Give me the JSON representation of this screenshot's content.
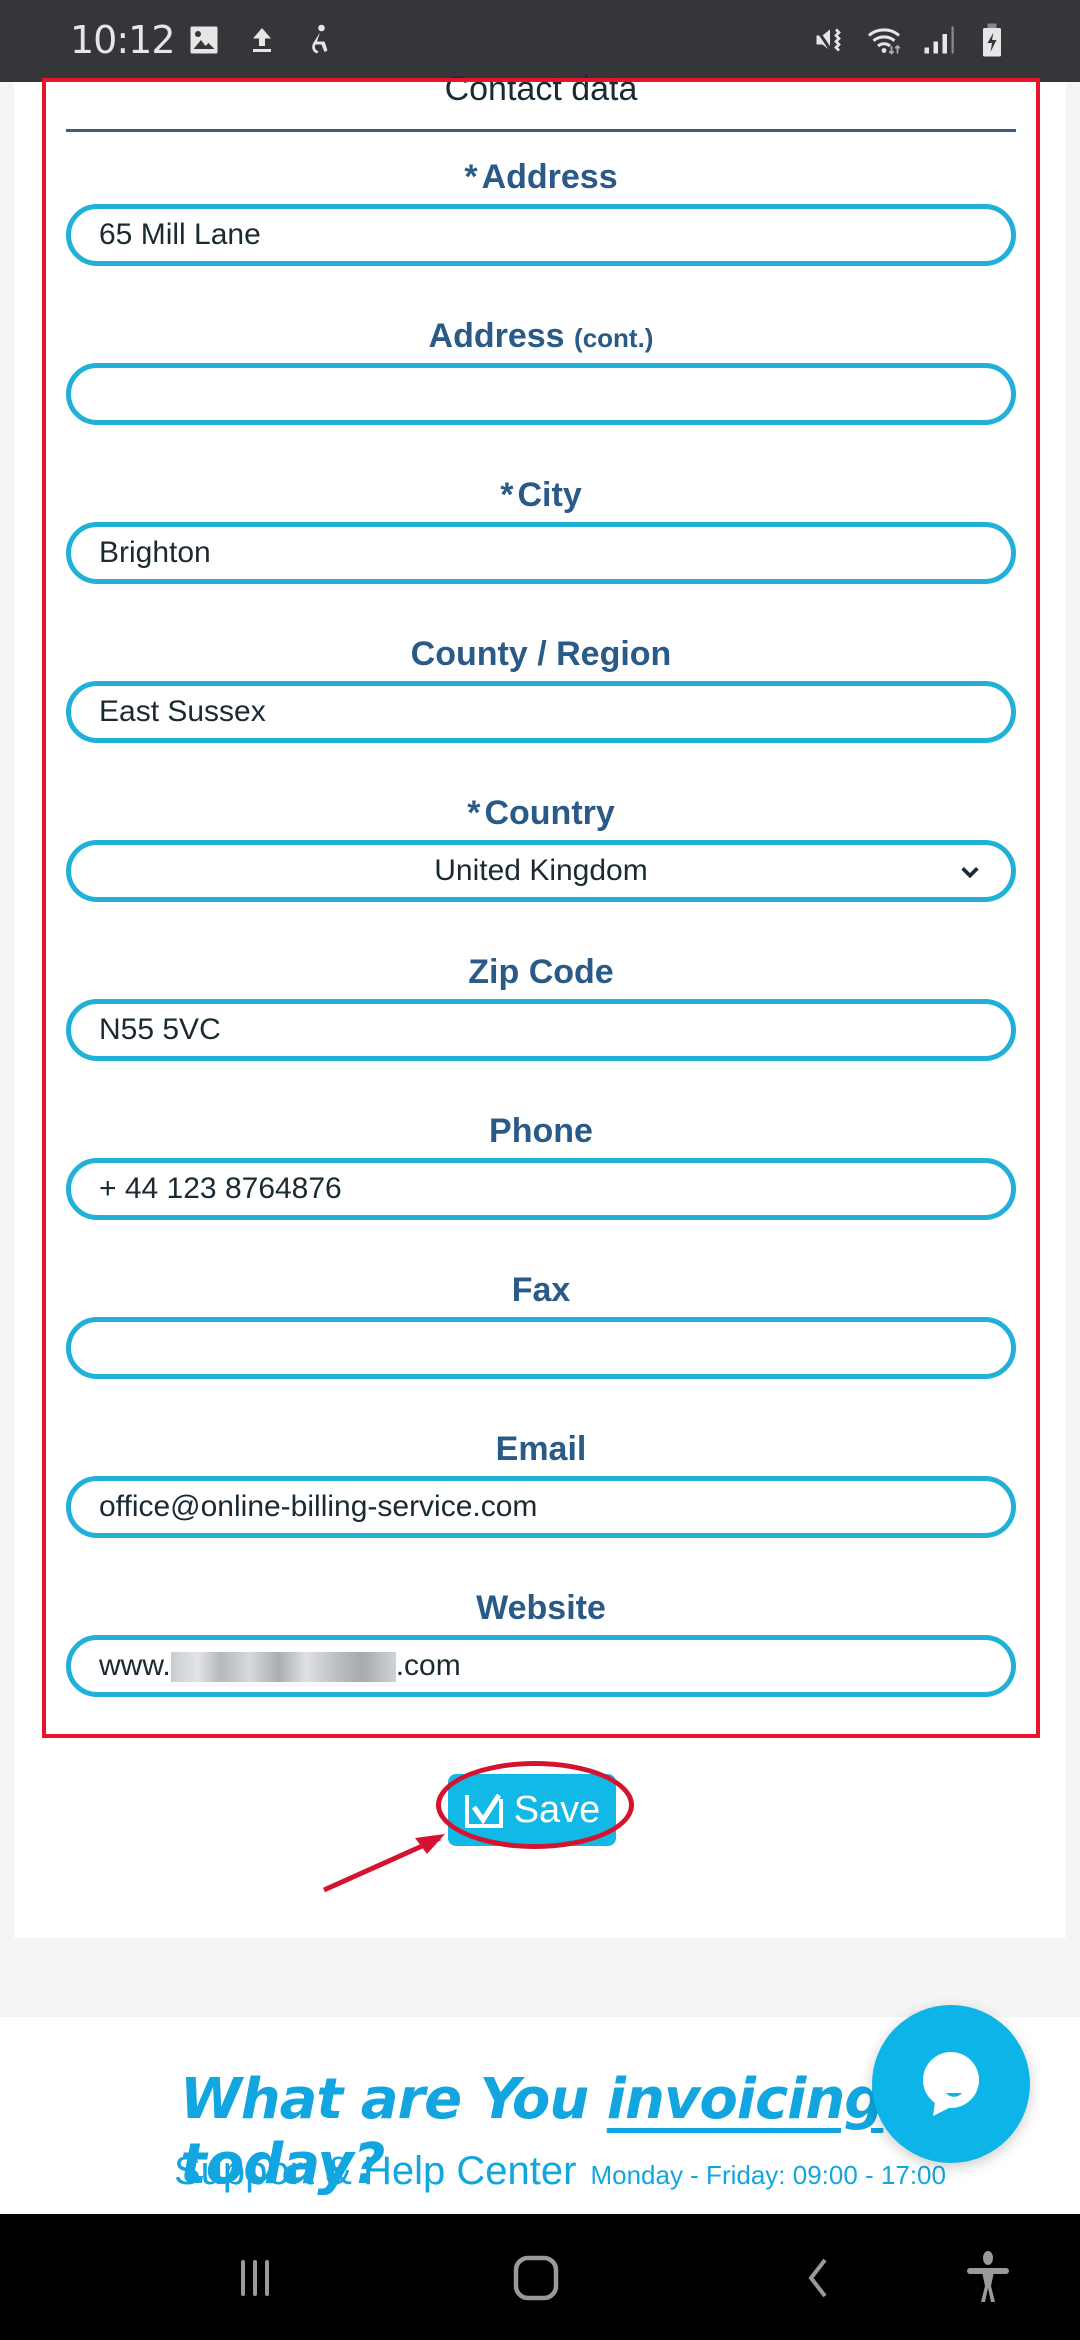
{
  "status_bar": {
    "time": "10:12",
    "left_icons": [
      "image-icon",
      "upload-icon",
      "accessibility-service-icon"
    ],
    "right_icons": [
      "mute-vibrate-icon",
      "wifi-icon",
      "signal-icon",
      "battery-charging-icon"
    ]
  },
  "form": {
    "section_title": "Contact data",
    "required_marker": "*",
    "fields": [
      {
        "label": "Address",
        "required": true,
        "value": "65 Mill Lane",
        "type": "text"
      },
      {
        "label": "Address",
        "label_suffix": "(cont.)",
        "required": false,
        "value": "",
        "type": "text"
      },
      {
        "label": "City",
        "required": true,
        "value": "Brighton",
        "type": "text"
      },
      {
        "label": "County / Region",
        "required": false,
        "value": "East Sussex",
        "type": "text"
      },
      {
        "label": "Country",
        "required": true,
        "value": "United Kingdom",
        "type": "select"
      },
      {
        "label": "Zip Code",
        "required": false,
        "value": "N55 5VC",
        "type": "text"
      },
      {
        "label": "Phone",
        "required": false,
        "value": "+ 44 123 8764876",
        "type": "text"
      },
      {
        "label": "Fax",
        "required": false,
        "value": "",
        "type": "text"
      },
      {
        "label": "Email",
        "required": false,
        "value": "office@online-billing-service.com",
        "type": "text"
      },
      {
        "label": "Website",
        "required": false,
        "value_prefix": "www.",
        "value_suffix": ".com",
        "value_redacted": true,
        "type": "text"
      }
    ],
    "save_label": "Save"
  },
  "footer": {
    "slogan_parts": [
      "What are You ",
      "invoicing",
      " today?"
    ],
    "support_title": "Support & Help Center",
    "support_hours": "Monday - Friday: 09:00 - 17:00"
  },
  "colors": {
    "accent": "#13b9e6",
    "label": "#2a5a88",
    "annotation": "#e8132d"
  }
}
